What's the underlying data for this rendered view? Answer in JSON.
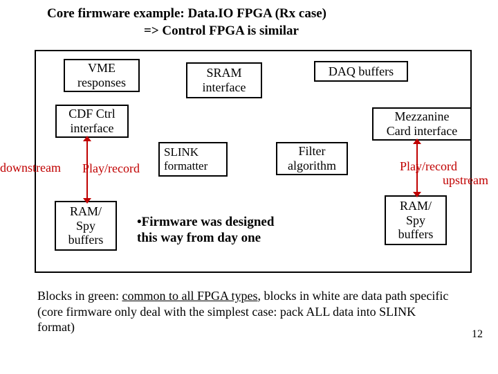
{
  "title_line1": "Core firmware example: Data.IO FPGA (Rx case)",
  "title_line2": "=> Control FPGA is similar",
  "boxes": {
    "vme": "VME\nresponses",
    "sram": "SRAM\ninterface",
    "daq": "DAQ buffers",
    "cdf": "CDF Ctrl\ninterface",
    "mezz": "Mezzanine\nCard interface",
    "slink": "SLINK\nformatter",
    "filter": "Filter\nalgorithm",
    "ram_left": "RAM/\nSpy\nbuffers",
    "ram_right": "RAM/\nSpy\nbuffers"
  },
  "labels": {
    "downstream": "downstream",
    "upstream": "upstream",
    "play_left": "Play/record",
    "play_right": "Play/record"
  },
  "bullet": "•Firmware was designed\n this way from day one",
  "footer_pre": "Blocks in green:  ",
  "footer_u": "common to all FPGA types",
  "footer_post": ", blocks in white are data path specific (core firmware only deal with the simplest case:  pack ALL data into SLINK format)",
  "pagenum": "12"
}
